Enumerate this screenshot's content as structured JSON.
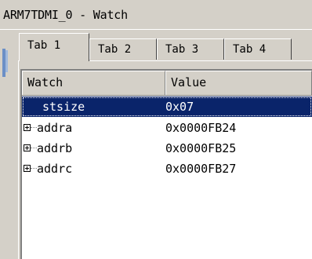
{
  "window": {
    "title": "ARM7TDMI_0 - Watch"
  },
  "tabs": [
    {
      "label": "Tab 1",
      "active": true
    },
    {
      "label": "Tab 2",
      "active": false
    },
    {
      "label": "Tab 3",
      "active": false
    },
    {
      "label": "Tab 4",
      "active": false
    }
  ],
  "list": {
    "columns": [
      "Watch",
      "Value"
    ],
    "rows": [
      {
        "name": "stsize",
        "value": "0x07",
        "expandable": false,
        "selected": true
      },
      {
        "name": "addra",
        "value": "0x0000FB24",
        "expandable": true,
        "selected": false
      },
      {
        "name": "addrb",
        "value": "0x0000FB25",
        "expandable": true,
        "selected": false
      },
      {
        "name": "addrc",
        "value": "0x0000FB27",
        "expandable": true,
        "selected": false
      }
    ]
  },
  "colors": {
    "selection": "#0a246a",
    "face": "#d4d0c8"
  },
  "icons": {
    "expand": "plus-box-icon"
  }
}
